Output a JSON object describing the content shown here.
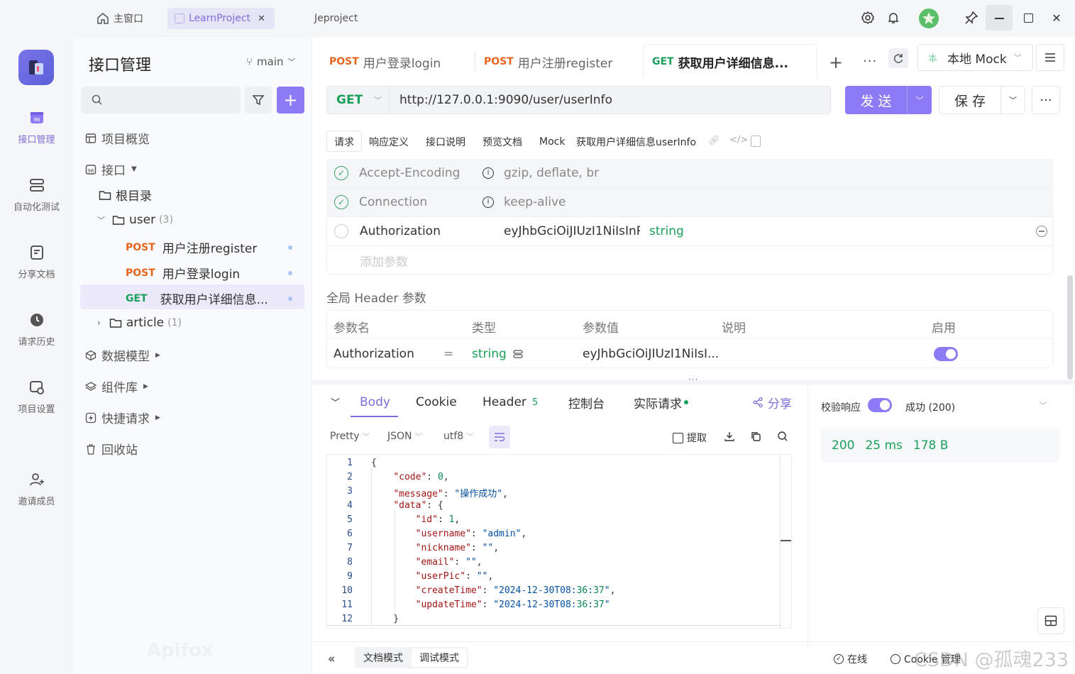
{
  "window": {
    "tabs": [
      {
        "label": "主窗口"
      },
      {
        "label": "LearnProject"
      },
      {
        "label": "Jeproject"
      }
    ]
  },
  "rail": {
    "items": [
      {
        "label": "接口管理"
      },
      {
        "label": "自动化测试"
      },
      {
        "label": "分享文档"
      },
      {
        "label": "请求历史"
      },
      {
        "label": "项目设置"
      },
      {
        "label": "邀请成员"
      }
    ]
  },
  "sidebar": {
    "title": "接口管理",
    "branch": "main",
    "overview": "项目概览",
    "apis": "接口",
    "root": "根目录",
    "folder_user": "user",
    "folder_user_count": "(3)",
    "items": [
      {
        "method": "POST",
        "name": "用户注册register"
      },
      {
        "method": "POST",
        "name": "用户登录login"
      },
      {
        "method": "GET",
        "name": "获取用户详细信息..."
      }
    ],
    "folder_article": "article",
    "folder_article_count": "(1)",
    "data_model": "数据模型",
    "components": "组件库",
    "quick_request": "快捷请求",
    "recycle": "回收站",
    "watermark": "Apifox"
  },
  "request_tabs": [
    {
      "method": "POST",
      "name": "用户登录login"
    },
    {
      "method": "POST",
      "name": "用户注册register"
    },
    {
      "method": "GET",
      "name": "获取用户详细信息..."
    }
  ],
  "env": {
    "badge": "本",
    "label": "本地 Mock"
  },
  "request": {
    "method": "GET",
    "url": "http://127.0.0.1:9090/user/userInfo",
    "send": "发 送",
    "save": "保 存"
  },
  "sub_tabs": [
    "请求",
    "响应定义",
    "接口说明",
    "预览文档",
    "Mock"
  ],
  "endpoint_name": "获取用户详细信息userInfo",
  "headers": [
    {
      "name": "Accept-Encoding",
      "value": "gzip, deflate, br",
      "type": ""
    },
    {
      "name": "Connection",
      "value": "keep-alive",
      "type": ""
    },
    {
      "name": "Authorization",
      "value": "eyJhbGciOiJIUzI1NiIsInR5",
      "type": "string"
    }
  ],
  "add_param_placeholder": "添加参数",
  "global_header": {
    "title": "全局 Header 参数",
    "columns": [
      "参数名",
      "类型",
      "参数值",
      "说明",
      "启用"
    ],
    "row": {
      "name": "Authorization",
      "eq": "=",
      "type": "string",
      "value": "eyJhbGciOiJIUzI1NiIsI..."
    }
  },
  "response_tabs": [
    {
      "label": "Body"
    },
    {
      "label": "Cookie"
    },
    {
      "label": "Header",
      "badge": "5"
    },
    {
      "label": "控制台"
    },
    {
      "label": "实际请求"
    }
  ],
  "share": "分享",
  "format": {
    "pretty": "Pretty",
    "json": "JSON",
    "encoding": "utf8",
    "extract": "提取"
  },
  "code_lines": [
    "{",
    "    \"code\": 0,",
    "    \"message\": \"操作成功\",",
    "    \"data\": {",
    "        \"id\": 1,",
    "        \"username\": \"admin\",",
    "        \"nickname\": \"\",",
    "        \"email\": \"\",",
    "        \"userPic\": \"\",",
    "        \"createTime\": \"2024-12-30T08:36:37\",",
    "        \"updateTime\": \"2024-12-30T08:36:37\"",
    "    }"
  ],
  "line_numbers": [
    "1",
    "2",
    "3",
    "4",
    "5",
    "6",
    "7",
    "8",
    "9",
    "10",
    "11",
    "12"
  ],
  "validation": {
    "label": "校验响应",
    "result": "成功 (200)",
    "status": "200",
    "time": "25 ms",
    "size": "178 B"
  },
  "footer": {
    "doc_mode": "文档模式",
    "debug_mode": "调试模式",
    "online": "在线",
    "cookie": "Cookie 管理",
    "watermark": "CSDN @孤魂233"
  },
  "colors": {
    "accent": "#8b7cf6",
    "post": "#e6641e",
    "get": "#1aa05a"
  }
}
